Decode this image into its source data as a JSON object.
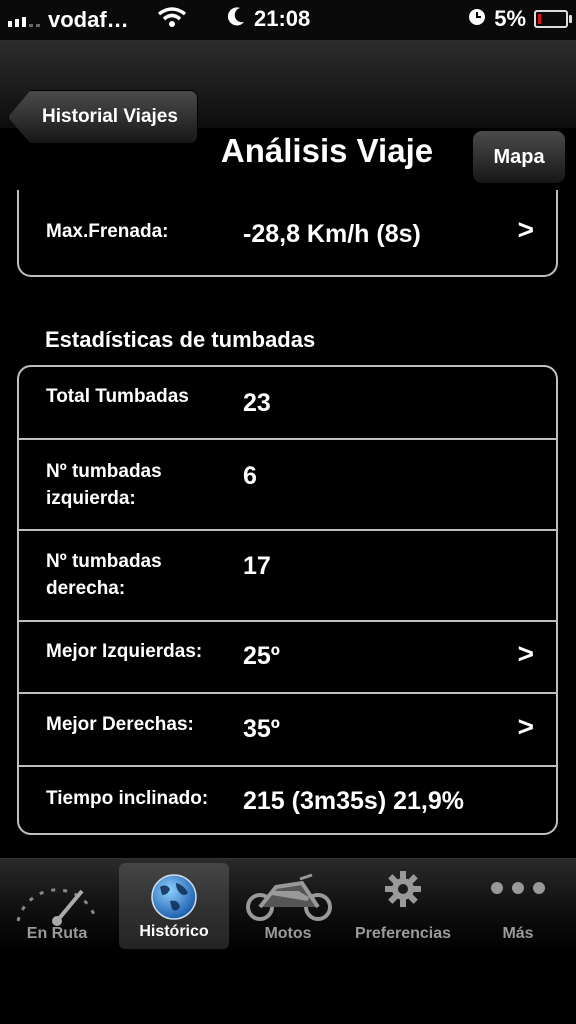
{
  "status_bar": {
    "carrier": "vodaf…",
    "time": "21:08",
    "battery": "5%"
  },
  "nav": {
    "back_label": "Historial Viajes",
    "title": "Análisis Viaje",
    "right_label": "Mapa"
  },
  "top_group": {
    "rows": [
      {
        "label": "Max.Frenada:",
        "value": "-28,8 Km/h (8s)"
      }
    ]
  },
  "section_title": "Estadísticas de tumbadas",
  "stats": {
    "rows": [
      {
        "label": "Total Tumbadas",
        "value": "23"
      },
      {
        "label": "Nº tumbadas\nizquierda:",
        "value": "6"
      },
      {
        "label": "Nº tumbadas\nderecha:",
        "value": "17"
      },
      {
        "label": "Mejor Izquierdas:",
        "value": "25º"
      },
      {
        "label": "Mejor Derechas:",
        "value": "35º"
      },
      {
        "label": "Tiempo inclinado:",
        "value": "215 (3m35s) 21,9%"
      }
    ]
  },
  "tabs": [
    {
      "label": "En Ruta",
      "icon": "speedometer-icon"
    },
    {
      "label": "Histórico",
      "icon": "globe-icon",
      "active": true
    },
    {
      "label": "Motos",
      "icon": "motorcycle-icon"
    },
    {
      "label": "Preferencias",
      "icon": "gear-icon"
    },
    {
      "label": "Más",
      "icon": "more-dots-icon"
    }
  ]
}
